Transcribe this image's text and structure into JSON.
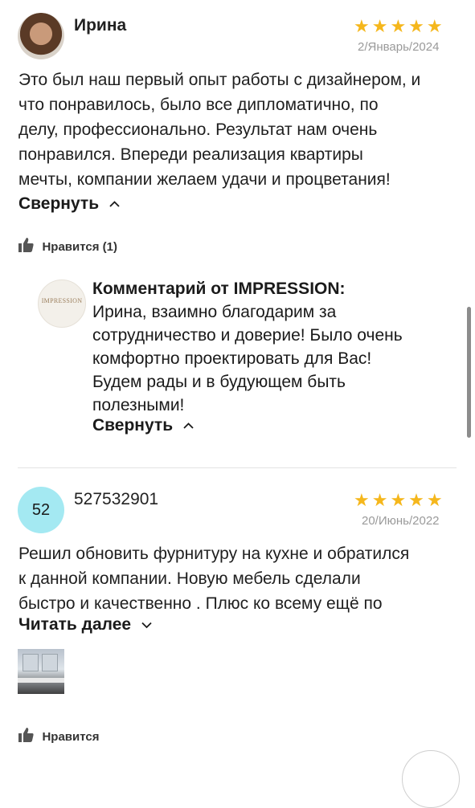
{
  "review1": {
    "author": "Ирина",
    "stars": "★★★★★",
    "date": "2/Январь/2024",
    "text_lines": [
      "Это был наш первый опыт работы с дизайнером, и",
      "что понравилось, было все дипломатично, по",
      "делу, профессионально. Результат нам очень",
      "понравился. Впереди реализация квартиры",
      "мечты, компании желаем удачи и процветания!"
    ],
    "collapse_label": "Свернуть",
    "like_label": "Нравится (1)"
  },
  "company_reply": {
    "logo_text": "IMPRESSION",
    "title": "Комментарий от IMPRESSION:",
    "text_lines": [
      "Ирина, взаимно благодарим за",
      "сотрудничество и доверие! Было очень",
      "комфортно проектировать для Вас!",
      "Будем рады и в будующем быть",
      "полезными!"
    ],
    "collapse_label": "Свернуть"
  },
  "review2": {
    "avatar_text": "52",
    "author": "527532901",
    "stars": "★★★★★",
    "date": "20/Июнь/2022",
    "text_lines": [
      "Решил обновить фурнитуру на кухне и обратился",
      "к данной компании. Новую мебель сделали",
      "быстро и качественно . Плюс ко всему ещё по"
    ],
    "read_more_label": "Читать далее",
    "like_label": "Нравится"
  },
  "colors": {
    "star": "#f5b71c",
    "avatar_bg": "#a4e9f2",
    "date": "#9a9a9a"
  }
}
